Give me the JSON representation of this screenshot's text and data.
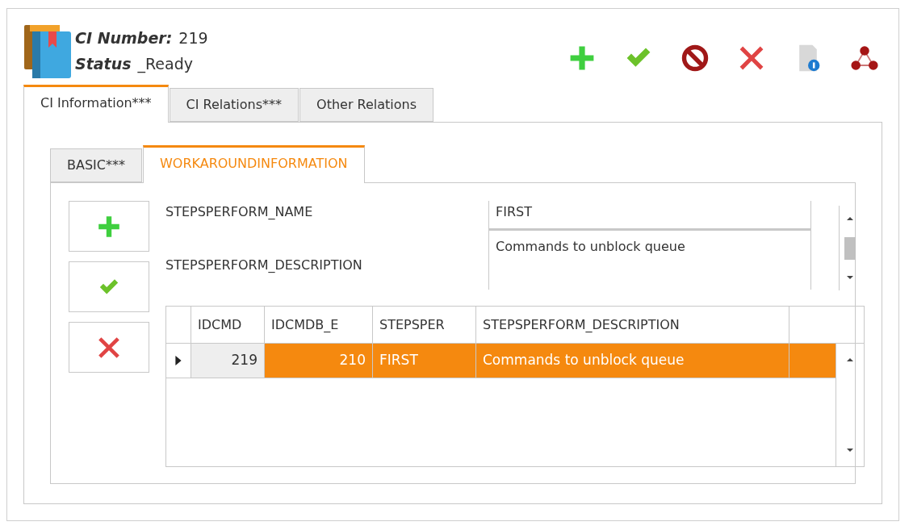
{
  "header": {
    "number_label": "CI Number:",
    "number": "219",
    "status_label": "Status",
    "status": "_Ready"
  },
  "tabs": [
    {
      "label": "CI Information***",
      "selected": true
    },
    {
      "label": "CI Relations***",
      "selected": false
    },
    {
      "label": "Other Relations",
      "selected": false
    }
  ],
  "sub_tabs": [
    {
      "label": "BASIC***",
      "selected": false
    },
    {
      "label": "WORKAROUNDINFORMATION",
      "selected": true
    }
  ],
  "form": {
    "fields": [
      {
        "label": "STEPSPERFORM_NAME",
        "value": "FIRST",
        "kind": "single"
      },
      {
        "label": "STEPSPERFORM_DESCRIPTION",
        "value": "Commands to unblock queue",
        "kind": "multi"
      }
    ]
  },
  "grid": {
    "columns": [
      {
        "label": "IDCMD",
        "kind": "key"
      },
      {
        "label": "IDCMDB_E",
        "kind": "number"
      },
      {
        "label": "STEPSPER",
        "kind": "text"
      },
      {
        "label": "STEPSPERFORM_DESCRIPTION",
        "kind": "text"
      }
    ],
    "rows": [
      {
        "cells": [
          "219",
          "210",
          "FIRST",
          "Commands to unblock queue"
        ],
        "selected": true
      }
    ]
  }
}
